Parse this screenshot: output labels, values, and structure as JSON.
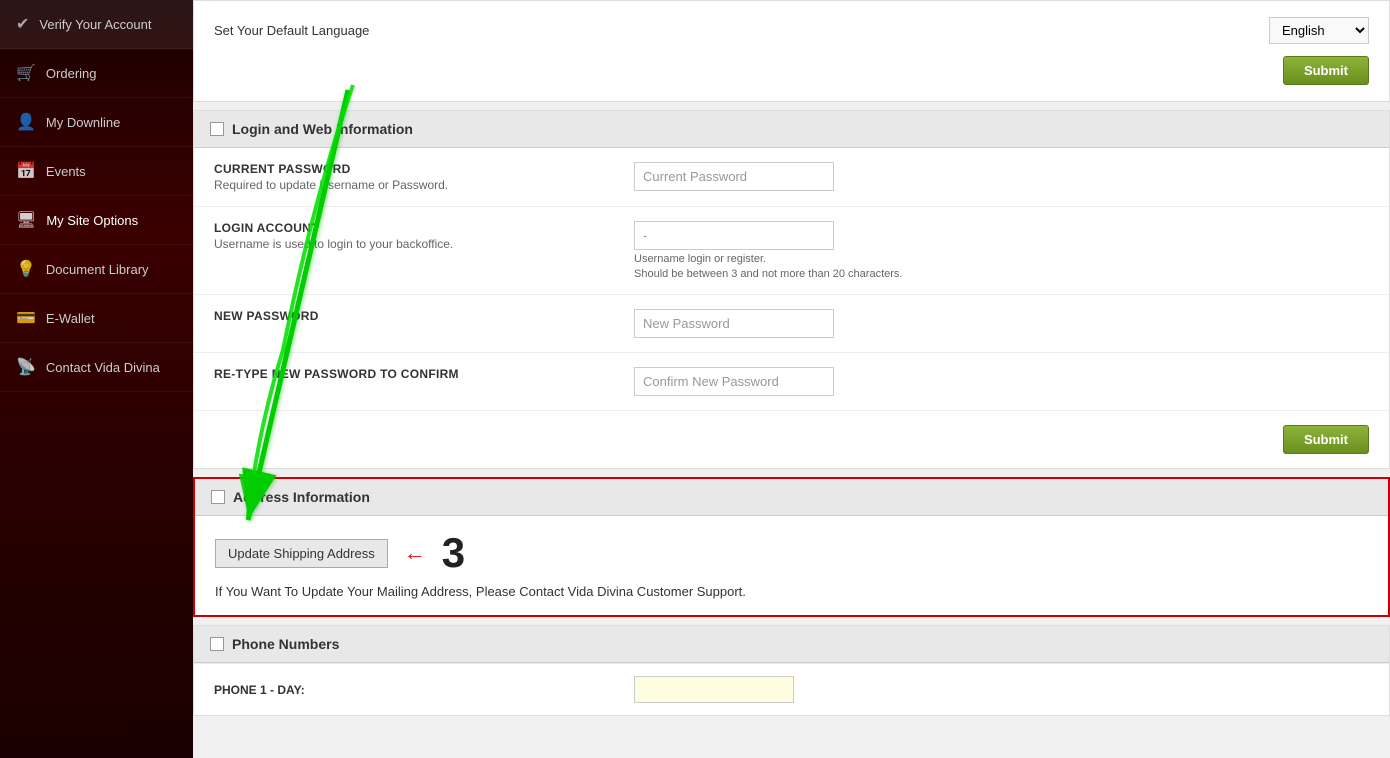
{
  "sidebar": {
    "items": [
      {
        "id": "verify-account",
        "label": "Verify Your Account",
        "icon": "✔"
      },
      {
        "id": "ordering",
        "label": "Ordering",
        "icon": "🛒"
      },
      {
        "id": "my-downline",
        "label": "My Downline",
        "icon": "👤"
      },
      {
        "id": "events",
        "label": "Events",
        "icon": "📅"
      },
      {
        "id": "my-site-options",
        "label": "My Site Options",
        "icon": "🖥",
        "active": true
      },
      {
        "id": "document-library",
        "label": "Document Library",
        "icon": "💡"
      },
      {
        "id": "e-wallet",
        "label": "E-Wallet",
        "icon": "💳"
      },
      {
        "id": "contact-vida-divina",
        "label": "Contact Vida Divina",
        "icon": "📡"
      }
    ]
  },
  "top_section": {
    "language_label": "Set Your Default Language",
    "language_value": "English",
    "submit_label": "Submit"
  },
  "login_section": {
    "header": "Login and Web Information",
    "fields": [
      {
        "id": "current-password",
        "title": "CURRENT PASSWORD",
        "desc": "Required to update Username or Password.",
        "placeholder": "Current Password"
      },
      {
        "id": "login-account",
        "title": "LOGIN ACCOUNT",
        "desc": "Username is used to login to your backoffice.",
        "value": "-",
        "hint1": "Username login or register.",
        "hint2": "Should be between 3 and not more than 20 characters."
      },
      {
        "id": "new-password",
        "title": "NEW PASSWORD",
        "desc": "",
        "placeholder": "New Password"
      },
      {
        "id": "retype-password",
        "title": "RE-TYPE NEW PASSWORD TO CONFIRM",
        "desc": "",
        "placeholder": "Confirm New Password"
      }
    ],
    "submit_label": "Submit"
  },
  "address_section": {
    "header": "Address Information",
    "update_btn_label": "Update Shipping Address",
    "note": "If You Want To Update Your Mailing Address, Please Contact Vida Divina Customer Support."
  },
  "phone_section": {
    "header": "Phone Numbers",
    "fields": [
      {
        "id": "phone1-day",
        "label": "PHONE 1 - DAY:",
        "value": ""
      }
    ]
  },
  "annotations": {
    "number_3": "3"
  }
}
